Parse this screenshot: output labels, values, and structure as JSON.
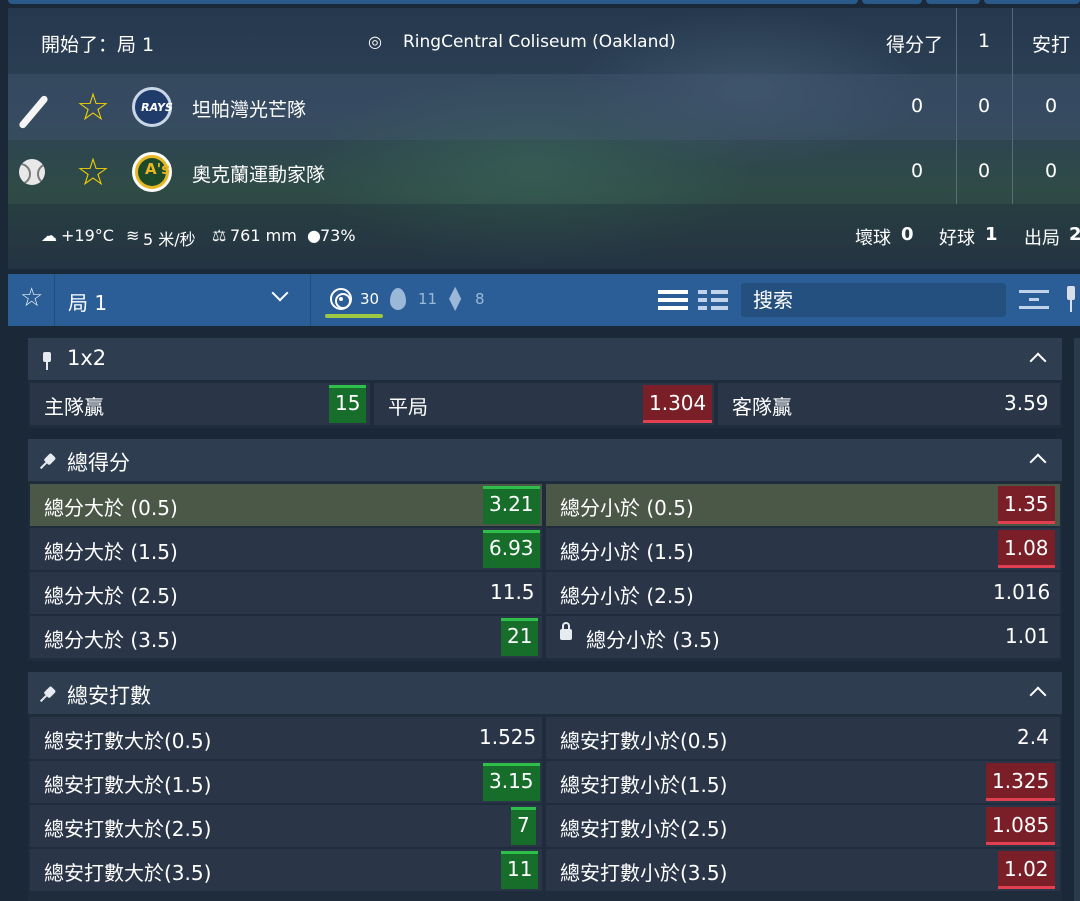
{
  "scoreboard": {
    "status": "開始了：局 1",
    "venue": "RingCentral Coliseum (Oakland)",
    "col_runs": "得分了",
    "col_inning": "1",
    "col_hits": "安打",
    "teams": [
      {
        "name": "坦帕灣光芒隊",
        "logo": "RAYS",
        "runs": "0",
        "inning1": "0",
        "hits": "0",
        "indicator": "bat-icon"
      },
      {
        "name": "奧克蘭運動家隊",
        "logo": "A's",
        "runs": "0",
        "inning1": "0",
        "hits": "0",
        "indicator": "baseball-icon"
      }
    ],
    "weather": {
      "temp": "+19°C",
      "wind": "5 米/秒",
      "pressure": "761 mm",
      "humidity": "73%"
    },
    "count": {
      "balls_label": "壞球",
      "balls": "0",
      "strikes_label": "好球",
      "strikes": "1",
      "outs_label": "出局",
      "outs": "2"
    }
  },
  "controls": {
    "period": "局 1",
    "markets_count": "30",
    "hot_count": "11",
    "sort_count": "8",
    "search_placeholder": "搜索"
  },
  "markets": [
    {
      "title": "1x2",
      "rows": [
        [
          {
            "label": "主隊贏",
            "value": "15",
            "trend": "up"
          },
          {
            "label": "平局",
            "value": "1.304",
            "trend": "down"
          },
          {
            "label": "客隊贏",
            "value": "3.59",
            "trend": "none"
          }
        ]
      ]
    },
    {
      "title": "總得分",
      "rows": [
        [
          {
            "label": "總分大於 (0.5)",
            "value": "3.21",
            "trend": "up"
          },
          {
            "label": "總分小於 (0.5)",
            "value": "1.35",
            "trend": "down"
          }
        ],
        [
          {
            "label": "總分大於 (1.5)",
            "value": "6.93",
            "trend": "up"
          },
          {
            "label": "總分小於 (1.5)",
            "value": "1.08",
            "trend": "down"
          }
        ],
        [
          {
            "label": "總分大於 (2.5)",
            "value": "11.5",
            "trend": "none"
          },
          {
            "label": "總分小於 (2.5)",
            "value": "1.016",
            "trend": "none"
          }
        ],
        [
          {
            "label": "總分大於 (3.5)",
            "value": "21",
            "trend": "up"
          },
          {
            "label": "總分小於 (3.5)",
            "value": "1.01",
            "trend": "locked"
          }
        ]
      ]
    },
    {
      "title": "總安打數",
      "rows": [
        [
          {
            "label": "總安打數大於(0.5)",
            "value": "1.525",
            "trend": "none"
          },
          {
            "label": "總安打數小於(0.5)",
            "value": "2.4",
            "trend": "none"
          }
        ],
        [
          {
            "label": "總安打數大於(1.5)",
            "value": "3.15",
            "trend": "up"
          },
          {
            "label": "總安打數小於(1.5)",
            "value": "1.325",
            "trend": "down"
          }
        ],
        [
          {
            "label": "總安打數大於(2.5)",
            "value": "7",
            "trend": "up"
          },
          {
            "label": "總安打數小於(2.5)",
            "value": "1.085",
            "trend": "down"
          }
        ],
        [
          {
            "label": "總安打數大於(3.5)",
            "value": "11",
            "trend": "up"
          },
          {
            "label": "總安打數小於(3.5)",
            "value": "1.02",
            "trend": "down"
          }
        ]
      ]
    }
  ],
  "colors": {
    "up": "#166e2a",
    "down": "#7a1e28",
    "star": "#f2d200",
    "accent_bar": "#2b5d97"
  }
}
